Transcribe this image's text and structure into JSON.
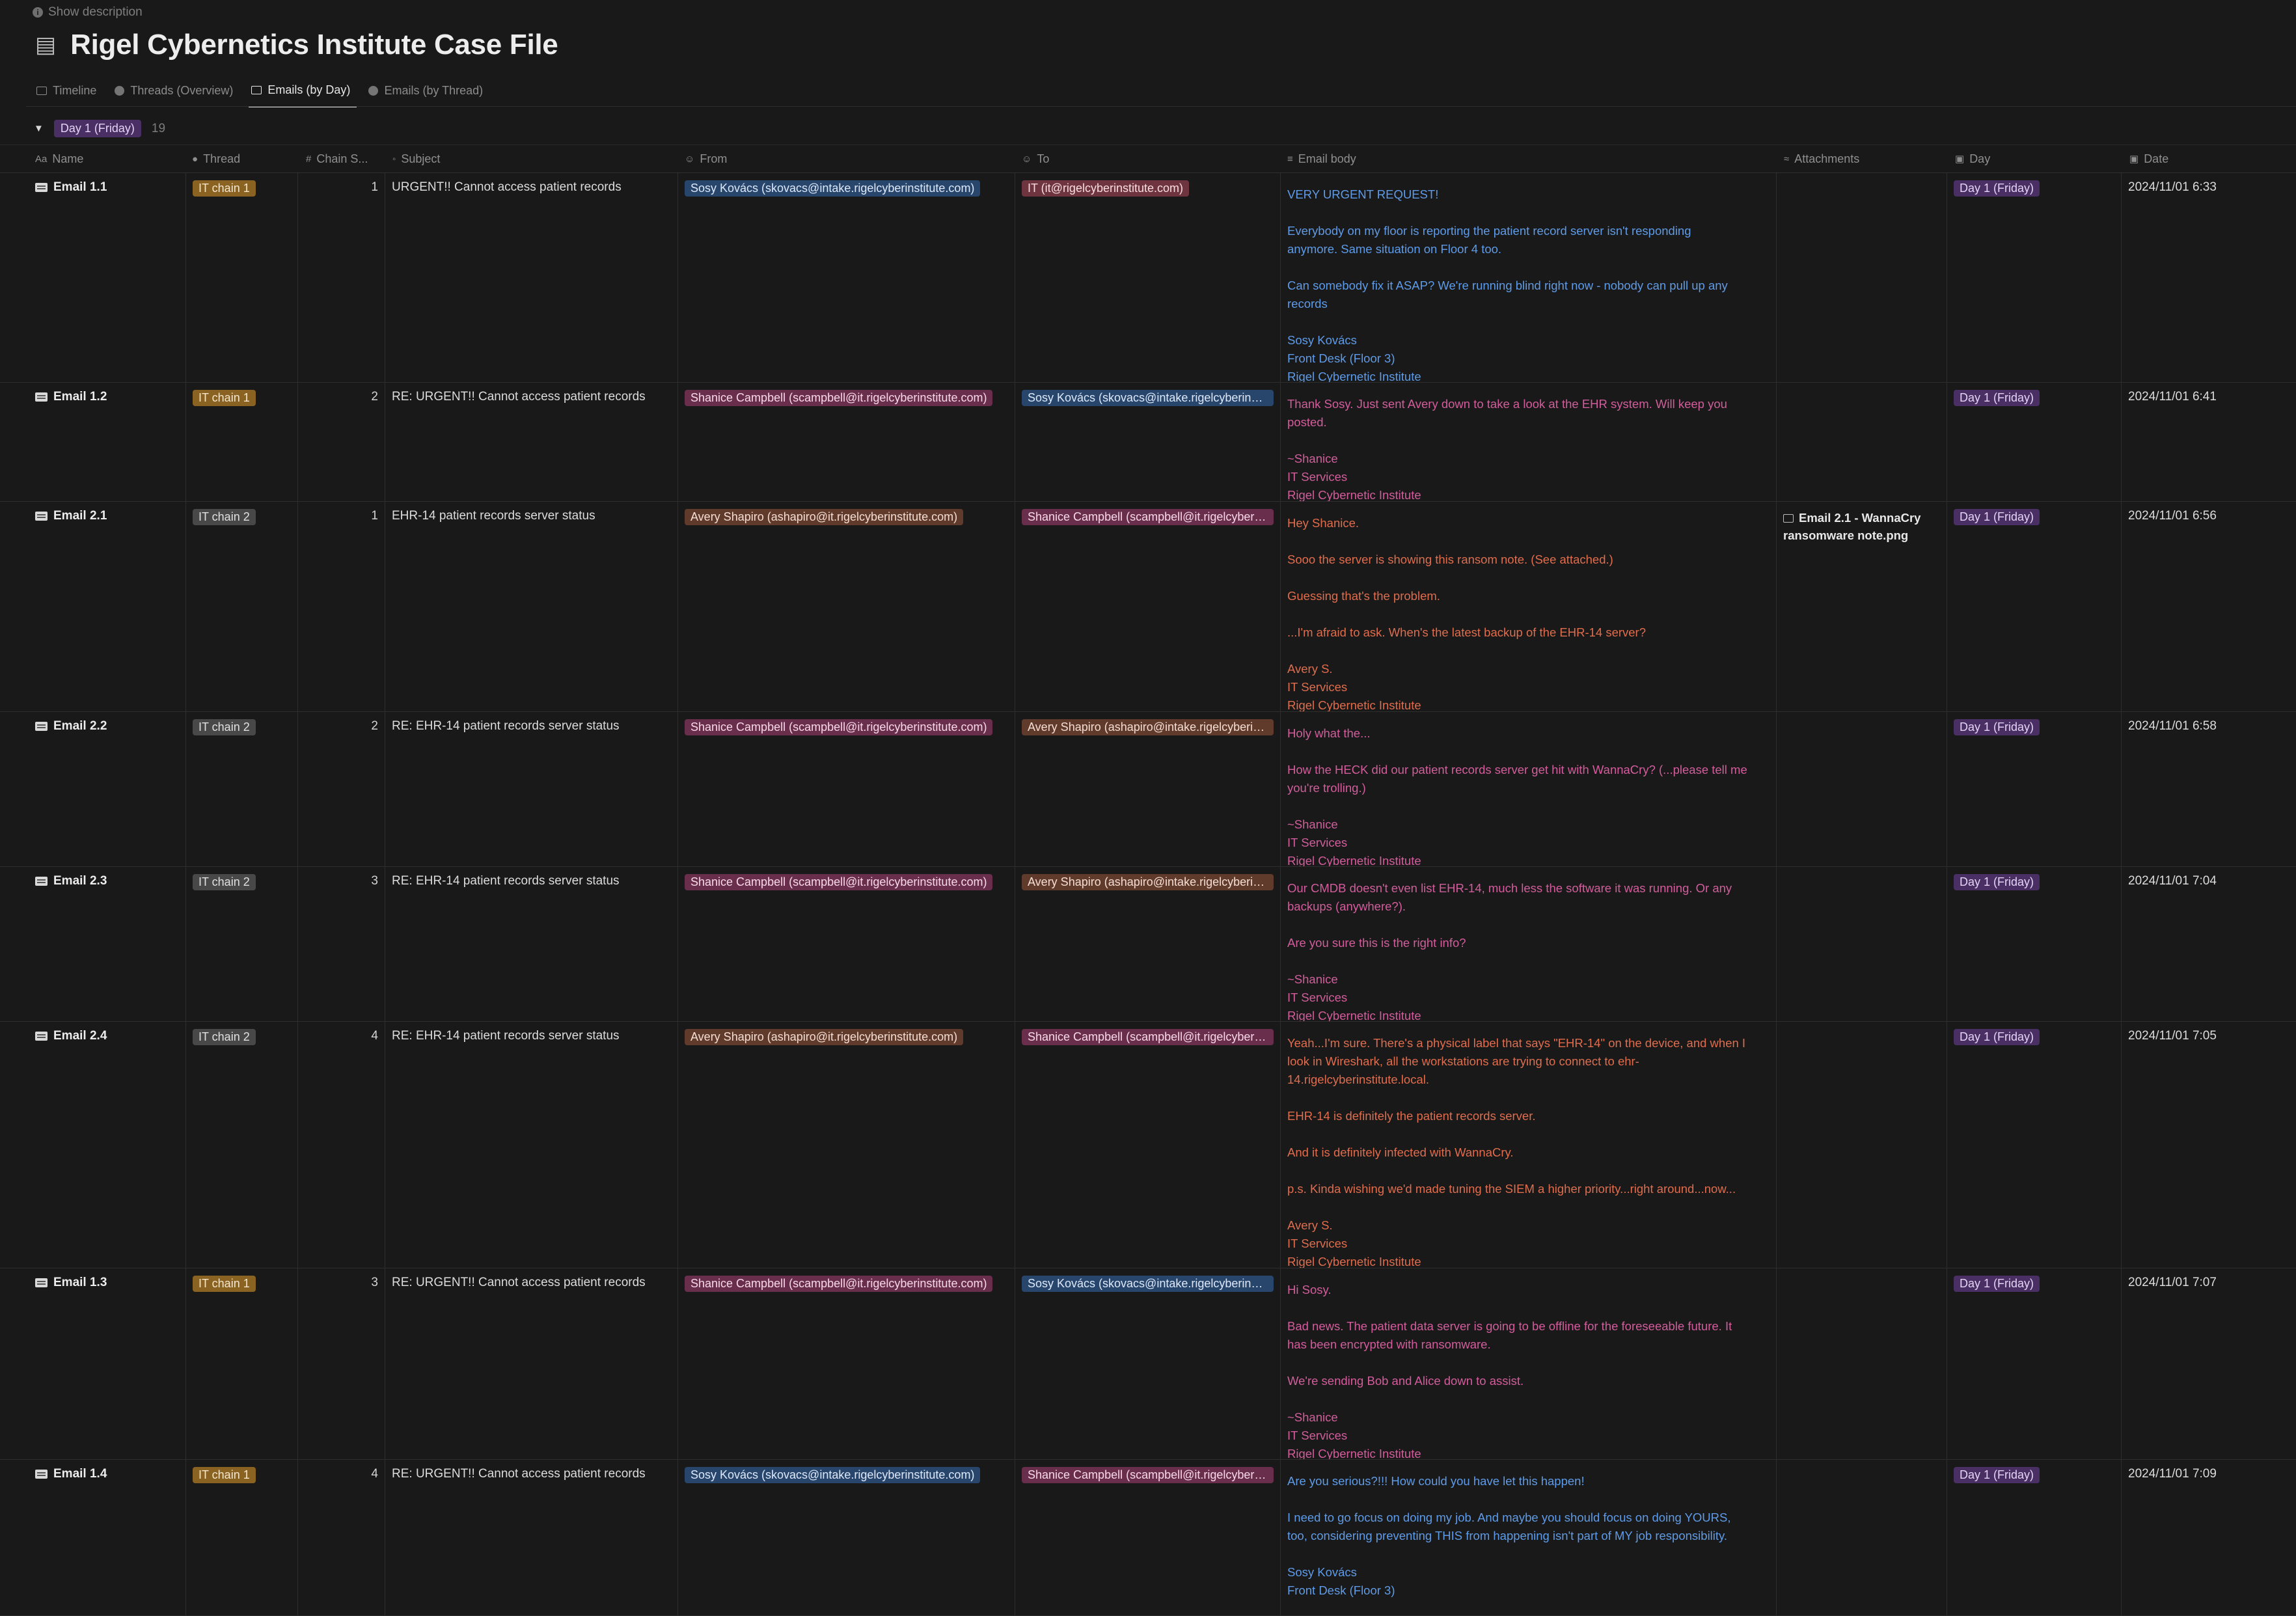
{
  "description_toggle": "Show description",
  "page": {
    "icon": "books-icon",
    "title": "Rigel Cybernetics Institute Case File"
  },
  "tabs": [
    {
      "label": "Timeline",
      "icon": "calendar-icon",
      "active": false
    },
    {
      "label": "Threads (Overview)",
      "icon": "chart-icon",
      "active": false
    },
    {
      "label": "Emails (by Day)",
      "icon": "table-icon",
      "active": true
    },
    {
      "label": "Emails (by Thread)",
      "icon": "chart-icon",
      "active": false
    }
  ],
  "group": {
    "label": "Day 1 (Friday)",
    "count": "19"
  },
  "columns": {
    "name": "Name",
    "thread": "Thread",
    "chain": "Chain S...",
    "subject": "Subject",
    "from": "From",
    "to": "To",
    "body": "Email body",
    "attachments": "Attachments",
    "day": "Day",
    "date": "Date"
  },
  "colors": {
    "blue": "#5e9be8",
    "red": "#e06a5b",
    "pink": "#d35d9c",
    "orange": "#e06d4d",
    "chain1": "#8a6221",
    "chain2": "#484848",
    "day": "#492f64"
  },
  "rows": [
    {
      "name": "Email 1.1",
      "thread": "IT chain 1",
      "chain": "1",
      "subject": "URGENT!! Cannot access patient records",
      "from": "Sosy Kovács (skovacs@intake.rigelcyberinstitute.com)",
      "to": "IT (it@rigelcyberinstitute.com)",
      "body": "VERY URGENT REQUEST!\n\nEverybody on my floor is reporting the patient record server isn't responding\nanymore. Same situation on Floor 4 too.\n\nCan somebody fix it ASAP? We're running blind right now - nobody can pull up any\nrecords\n\nSosy Kovács\nFront Desk (Floor 3)\nRigel Cybernetic Institute",
      "attachment": "",
      "day": "Day 1 (Friday)",
      "date": "2024/11/01 6:33"
    },
    {
      "name": "Email 1.2",
      "thread": "IT chain 1",
      "chain": "2",
      "subject": "RE: URGENT!! Cannot access patient records",
      "from": "Shanice Campbell (scampbell@it.rigelcyberinstitute.com)",
      "to": "Sosy Kovács (skovacs@intake.rigelcyberinstitute.com)",
      "body": "Thank Sosy. Just sent Avery down to take a look at the EHR system. Will keep you\nposted.\n\n~Shanice\nIT Services\nRigel Cybernetic Institute",
      "attachment": "",
      "day": "Day 1 (Friday)",
      "date": "2024/11/01 6:41"
    },
    {
      "name": "Email 2.1",
      "thread": "IT chain 2",
      "chain": "1",
      "subject": "EHR-14 patient records server status",
      "from": "Avery Shapiro (ashapiro@it.rigelcyberinstitute.com)",
      "to": "Shanice Campbell (scampbell@it.rigelcyberinstitute.com)",
      "body": "Hey Shanice.\n\nSooo the server is showing this ransom note. (See attached.)\n\nGuessing that's the problem.\n\n...I'm afraid to ask. When's the latest backup of the EHR-14 server?\n\nAvery S.\nIT Services\nRigel Cybernetic Institute",
      "attachment": "Email 2.1 - WannaCry ransomware note.png",
      "day": "Day 1 (Friday)",
      "date": "2024/11/01 6:56"
    },
    {
      "name": "Email 2.2",
      "thread": "IT chain 2",
      "chain": "2",
      "subject": "RE: EHR-14 patient records server status",
      "from": "Shanice Campbell (scampbell@it.rigelcyberinstitute.com)",
      "to": "Avery Shapiro (ashapiro@intake.rigelcyberinstitute.com)",
      "body": "Holy what the...\n\nHow the HECK did our patient records server get hit with WannaCry? (...please tell me\nyou're trolling.)\n\n~Shanice\nIT Services\nRigel Cybernetic Institute",
      "attachment": "",
      "day": "Day 1 (Friday)",
      "date": "2024/11/01 6:58"
    },
    {
      "name": "Email 2.3",
      "thread": "IT chain 2",
      "chain": "3",
      "subject": "RE: EHR-14 patient records server status",
      "from": "Shanice Campbell (scampbell@it.rigelcyberinstitute.com)",
      "to": "Avery Shapiro (ashapiro@intake.rigelcyberinstitute.com)",
      "body": "Our CMDB doesn't even list EHR-14, much less the software it was running. Or any\nbackups (anywhere?).\n\nAre you sure this is the right info?\n\n~Shanice\nIT Services\nRigel Cybernetic Institute",
      "attachment": "",
      "day": "Day 1 (Friday)",
      "date": "2024/11/01 7:04"
    },
    {
      "name": "Email 2.4",
      "thread": "IT chain 2",
      "chain": "4",
      "subject": "RE: EHR-14 patient records server status",
      "from": "Avery Shapiro (ashapiro@it.rigelcyberinstitute.com)",
      "to": "Shanice Campbell (scampbell@it.rigelcyberinstitute.com)",
      "body": "Yeah...I'm sure. There's a physical label that says \"EHR-14\" on the device, and when I\nlook in Wireshark, all the workstations are trying to connect to ehr-\n14.rigelcyberinstitute.local.\n\nEHR-14 is definitely the patient records server.\n\nAnd it is definitely infected with WannaCry.\n\np.s. Kinda wishing we'd made tuning the SIEM a higher priority...right around...now...\n\nAvery S.\nIT Services\nRigel Cybernetic Institute",
      "attachment": "",
      "day": "Day 1 (Friday)",
      "date": "2024/11/01 7:05"
    },
    {
      "name": "Email 1.3",
      "thread": "IT chain 1",
      "chain": "3",
      "subject": "RE: URGENT!! Cannot access patient records",
      "from": "Shanice Campbell (scampbell@it.rigelcyberinstitute.com)",
      "to": "Sosy Kovács (skovacs@intake.rigelcyberinstitute.com)",
      "body": "Hi Sosy.\n\nBad news. The patient data server is going to be offline for the foreseeable future. It\nhas been encrypted with ransomware.\n\nWe're sending Bob and Alice down to assist.\n\n~Shanice\nIT Services\nRigel Cybernetic Institute",
      "attachment": "",
      "day": "Day 1 (Friday)",
      "date": "2024/11/01 7:07"
    },
    {
      "name": "Email 1.4",
      "thread": "IT chain 1",
      "chain": "4",
      "subject": "RE: URGENT!! Cannot access patient records",
      "from": "Sosy Kovács (skovacs@intake.rigelcyberinstitute.com)",
      "to": "Shanice Campbell (scampbell@it.rigelcyberinstitute.com)",
      "body": "Are you serious?!!! How could you have let this happen!\n\nI need to go focus on doing my job. And maybe you should focus on doing YOURS,\ntoo, considering preventing THIS from happening isn't part of MY job responsibility.\n\nSosy Kovács\nFront Desk (Floor 3)",
      "attachment": "",
      "day": "Day 1 (Friday)",
      "date": "2024/11/01 7:09"
    }
  ]
}
